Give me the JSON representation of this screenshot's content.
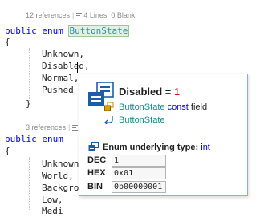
{
  "code_lens": [
    {
      "references": "12 references",
      "info": "4 Lines, 0 Blank"
    },
    {
      "references": "3 references",
      "info": ""
    }
  ],
  "enum1": {
    "keyword_public": "public",
    "keyword_enum": "enum",
    "name": "ButtonState",
    "open_brace": "{",
    "members": [
      "Unknown,",
      "Disabled,",
      "Normal,",
      "Pushed"
    ],
    "close_brace": "}"
  },
  "enum2": {
    "keyword_public": "public",
    "keyword_enum": "enum",
    "open_brace": "{",
    "members": [
      "Unknown,",
      "World,",
      "Backgro",
      "Low,",
      "Medi"
    ]
  },
  "tooltip": {
    "member_name": "Disabled",
    "equals": " = ",
    "member_value": "1",
    "type_name": "ButtonState",
    "type_kind": "const",
    "type_suffix": "field",
    "parent_name": "ButtonState",
    "underlying_label": "Enum underlying type:",
    "underlying_type": "int",
    "radix": [
      {
        "label": "DEC",
        "prefix": "",
        "value": "1"
      },
      {
        "label": "HEX",
        "prefix": "0x",
        "value": "01"
      },
      {
        "label": "BIN",
        "prefix": "0b",
        "value": "00000001"
      }
    ]
  },
  "icons": {
    "tooltip_member_icon": "enum-member-icon",
    "field_icon": "enum-type-icon",
    "parent_icon": "containing-type-icon",
    "enum_type_icon": "enum-type-icon",
    "lens_icon": "lines-icon"
  },
  "colors": {
    "keyword": "#0000ff",
    "type": "#2b91af",
    "tooltip_border": "#8ab0cf",
    "value_red": "#c81e1e"
  }
}
